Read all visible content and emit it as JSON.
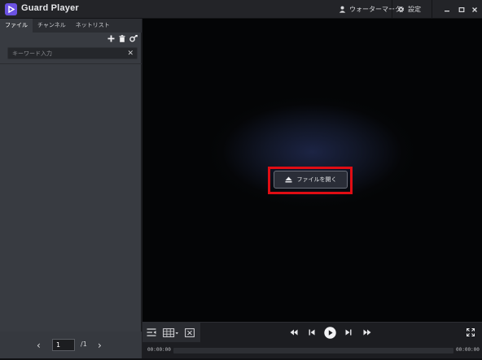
{
  "app": {
    "title": "Guard Player"
  },
  "header": {
    "watermark_label": "ウォーターマーク",
    "settings_label": "設定"
  },
  "sidebar": {
    "tabs": [
      {
        "label": "ファイル",
        "active": true
      },
      {
        "label": "チャンネル",
        "active": false
      },
      {
        "label": "ネットリスト",
        "active": false
      }
    ],
    "search_placeholder": "キーワード入力",
    "pager": {
      "current": "1",
      "total": "/1"
    }
  },
  "video": {
    "open_file_label": "ファイルを開く"
  },
  "playback": {
    "current_time": "00:00:00",
    "total_time": "00:00:00"
  },
  "colors": {
    "brand": "#6b52e3",
    "highlight": "#e00d14"
  }
}
